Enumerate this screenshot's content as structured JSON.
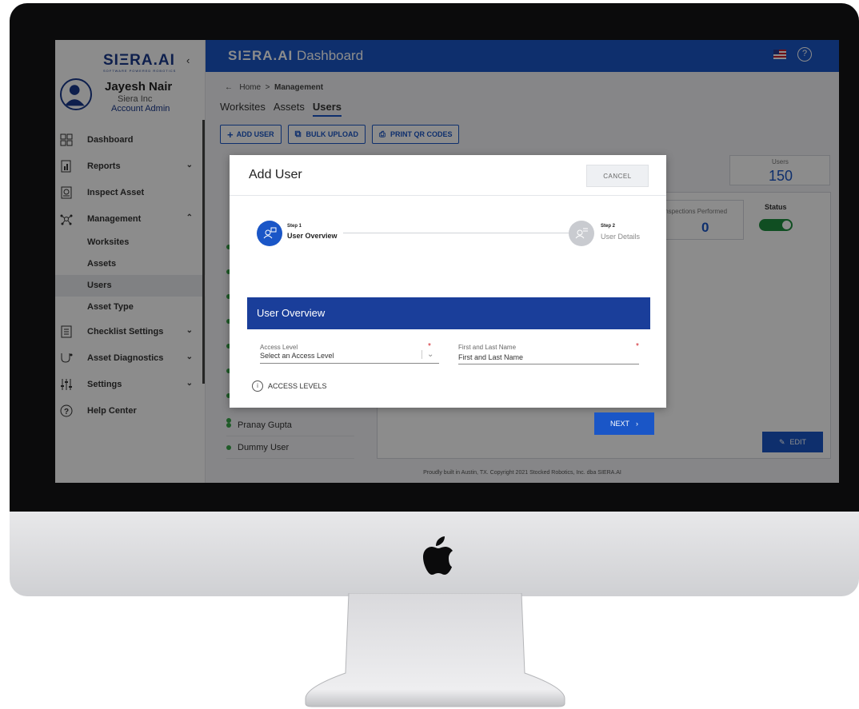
{
  "app": {
    "logo_text": "SIΞRA.AI",
    "logo_tagline": "SOFTWARE POWERED ROBOTICS",
    "title_brand": "SIΞRA.AI",
    "title_suffix": " Dashboard",
    "collapse_icon": "chevron-left-icon"
  },
  "user": {
    "name": "Jayesh Nair",
    "org": "Siera Inc",
    "role": "Account Admin"
  },
  "sidebar": {
    "items": [
      {
        "label": "Dashboard",
        "icon": "grid-icon"
      },
      {
        "label": "Reports",
        "icon": "report-icon",
        "chevron": "⌄"
      },
      {
        "label": "Inspect Asset",
        "icon": "inspect-icon"
      },
      {
        "label": "Management",
        "icon": "network-icon",
        "chevron": "⌃"
      }
    ],
    "sub_items": [
      {
        "label": "Worksites"
      },
      {
        "label": "Assets"
      },
      {
        "label": "Users"
      },
      {
        "label": "Asset Type"
      }
    ],
    "items_after": [
      {
        "label": "Checklist Settings",
        "icon": "checklist-icon",
        "chevron": "⌄"
      },
      {
        "label": "Asset Diagnostics",
        "icon": "diagnostics-icon",
        "chevron": "⌄"
      },
      {
        "label": "Settings",
        "icon": "sliders-icon",
        "chevron": "⌄"
      },
      {
        "label": "Help Center",
        "icon": "help-icon"
      }
    ]
  },
  "breadcrumb": {
    "arrow": "←",
    "home": "Home",
    "sep": ">",
    "current": "Management"
  },
  "tabs": [
    "Worksites",
    "Assets",
    "Users"
  ],
  "toolbar": {
    "add_user": "ADD USER",
    "bulk_upload": "BULK UPLOAD",
    "print_qr": "PRINT QR CODES"
  },
  "stats": {
    "users_label": "Users",
    "users_count": "150",
    "inspections_label": "Inspections Performed",
    "inspections_count": "0",
    "status_label": "Status"
  },
  "user_list": [
    {
      "name": "Pranay Gupta"
    },
    {
      "name": "Dummy User"
    }
  ],
  "edit_label": "EDIT",
  "footer": "Proudly built in Austin, TX. Copyright 2021 Stocked Robotics, Inc. dba SIERA.AI",
  "modal": {
    "title": "Add User",
    "cancel": "CANCEL",
    "step1_num": "Step 1",
    "step1_name": "User Overview",
    "step2_num": "Step 2",
    "step2_name": "User Details",
    "section_title": "User Overview",
    "access_level_label": "Access Level",
    "access_level_placeholder": "Select an Access Level",
    "name_label": "First and Last Name",
    "name_placeholder": "First and Last Name",
    "required_mark": "*",
    "access_levels_link": "ACCESS LEVELS",
    "next": "NEXT"
  },
  "colors": {
    "primary": "#1a56c7",
    "section": "#1a3e9a",
    "status_on": "#1e8e3e",
    "required": "#d0222a"
  }
}
